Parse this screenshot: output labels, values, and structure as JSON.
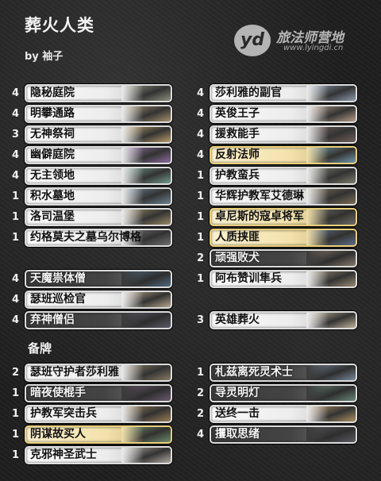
{
  "header": {
    "title": "葬火人类",
    "byline": "by 袖子"
  },
  "logo": {
    "mark": "yd",
    "name": "旅法师营地",
    "url": "www.lyingdi.cn"
  },
  "sideboard_label": "备牌",
  "main_left": [
    {
      "count": "4",
      "name": "隐秘庭院",
      "style": "light",
      "art": "#8a8f7a"
    },
    {
      "count": "4",
      "name": "明攀通路",
      "style": "light",
      "art": "#a58f6a"
    },
    {
      "count": "3",
      "name": "无神祭祠",
      "style": "light",
      "art": "#b99a62"
    },
    {
      "count": "4",
      "name": "幽僻庭院",
      "style": "light",
      "art": "#8c6aa0"
    },
    {
      "count": "4",
      "name": "无主领地",
      "style": "light",
      "art": "#6f9a8a"
    },
    {
      "count": "1",
      "name": "积水墓地",
      "style": "light",
      "art": "#6a8190"
    },
    {
      "count": "1",
      "name": "洛司温堡",
      "style": "light",
      "art": "#9a8a62"
    },
    {
      "count": "1",
      "name": "约格莫夫之墓乌尔博格",
      "style": "light",
      "art": "#6e6e6e"
    },
    {
      "count": "4",
      "name": "天魔祟体僧",
      "style": "dark",
      "art": "#4f6a80"
    },
    {
      "count": "4",
      "name": "瑟班巡检官",
      "style": "light",
      "art": "#b8a78c"
    },
    {
      "count": "4",
      "name": "弃神僧侣",
      "style": "dark",
      "art": "#5b5b6a"
    }
  ],
  "main_right": [
    {
      "count": "4",
      "name": "莎利雅的副官",
      "style": "light",
      "art": "#8c9ab0"
    },
    {
      "count": "4",
      "name": "英俊王子",
      "style": "light",
      "art": "#b79a86"
    },
    {
      "count": "4",
      "name": "援救能手",
      "style": "light",
      "art": "#6f5a58"
    },
    {
      "count": "4",
      "name": "反射法师",
      "style": "gold",
      "art": "#6f9ab4"
    },
    {
      "count": "1",
      "name": "护教蛮兵",
      "style": "light",
      "art": "#7a7a6a"
    },
    {
      "count": "1",
      "name": "华辉护教军艾德琳",
      "style": "light",
      "art": "#7a6a50"
    },
    {
      "count": "1",
      "name": "卓尼斯的寇卓将军",
      "style": "gold",
      "art": "#6a6a6a"
    },
    {
      "count": "1",
      "name": "人质挟匪",
      "style": "gold",
      "art": "#5a6f90"
    },
    {
      "count": "2",
      "name": "顽强败犬",
      "style": "dark",
      "art": "#8a7a6a"
    },
    {
      "count": "1",
      "name": "阿布赞训隼兵",
      "style": "light",
      "art": "#9a8a70"
    },
    {
      "count": "3",
      "name": "英雄葬火",
      "style": "light",
      "art": "#c0b29a"
    }
  ],
  "side_left": [
    {
      "count": "2",
      "name": "瑟班守护者莎利雅",
      "style": "light",
      "art": "#8a7a60"
    },
    {
      "count": "1",
      "name": "暗夜使棍手",
      "style": "dark",
      "art": "#6a5a70"
    },
    {
      "count": "1",
      "name": "护教军突击兵",
      "style": "light",
      "art": "#9a7a50"
    },
    {
      "count": "1",
      "name": "阴谋故买人",
      "style": "gold",
      "art": "#6a8a70"
    },
    {
      "count": "1",
      "name": "克邪神圣武士",
      "style": "light",
      "art": "#b0a8a0"
    }
  ],
  "side_right": [
    {
      "count": "1",
      "name": "札兹离死灵术士",
      "style": "dark",
      "art": "#7a8aa0"
    },
    {
      "count": "2",
      "name": "导灵明灯",
      "style": "dark",
      "art": "#6a8a7a"
    },
    {
      "count": "2",
      "name": "送终一击",
      "style": "light",
      "art": "#b09060"
    },
    {
      "count": "4",
      "name": "攫取思绪",
      "style": "dark",
      "art": "#5a5a60"
    }
  ]
}
